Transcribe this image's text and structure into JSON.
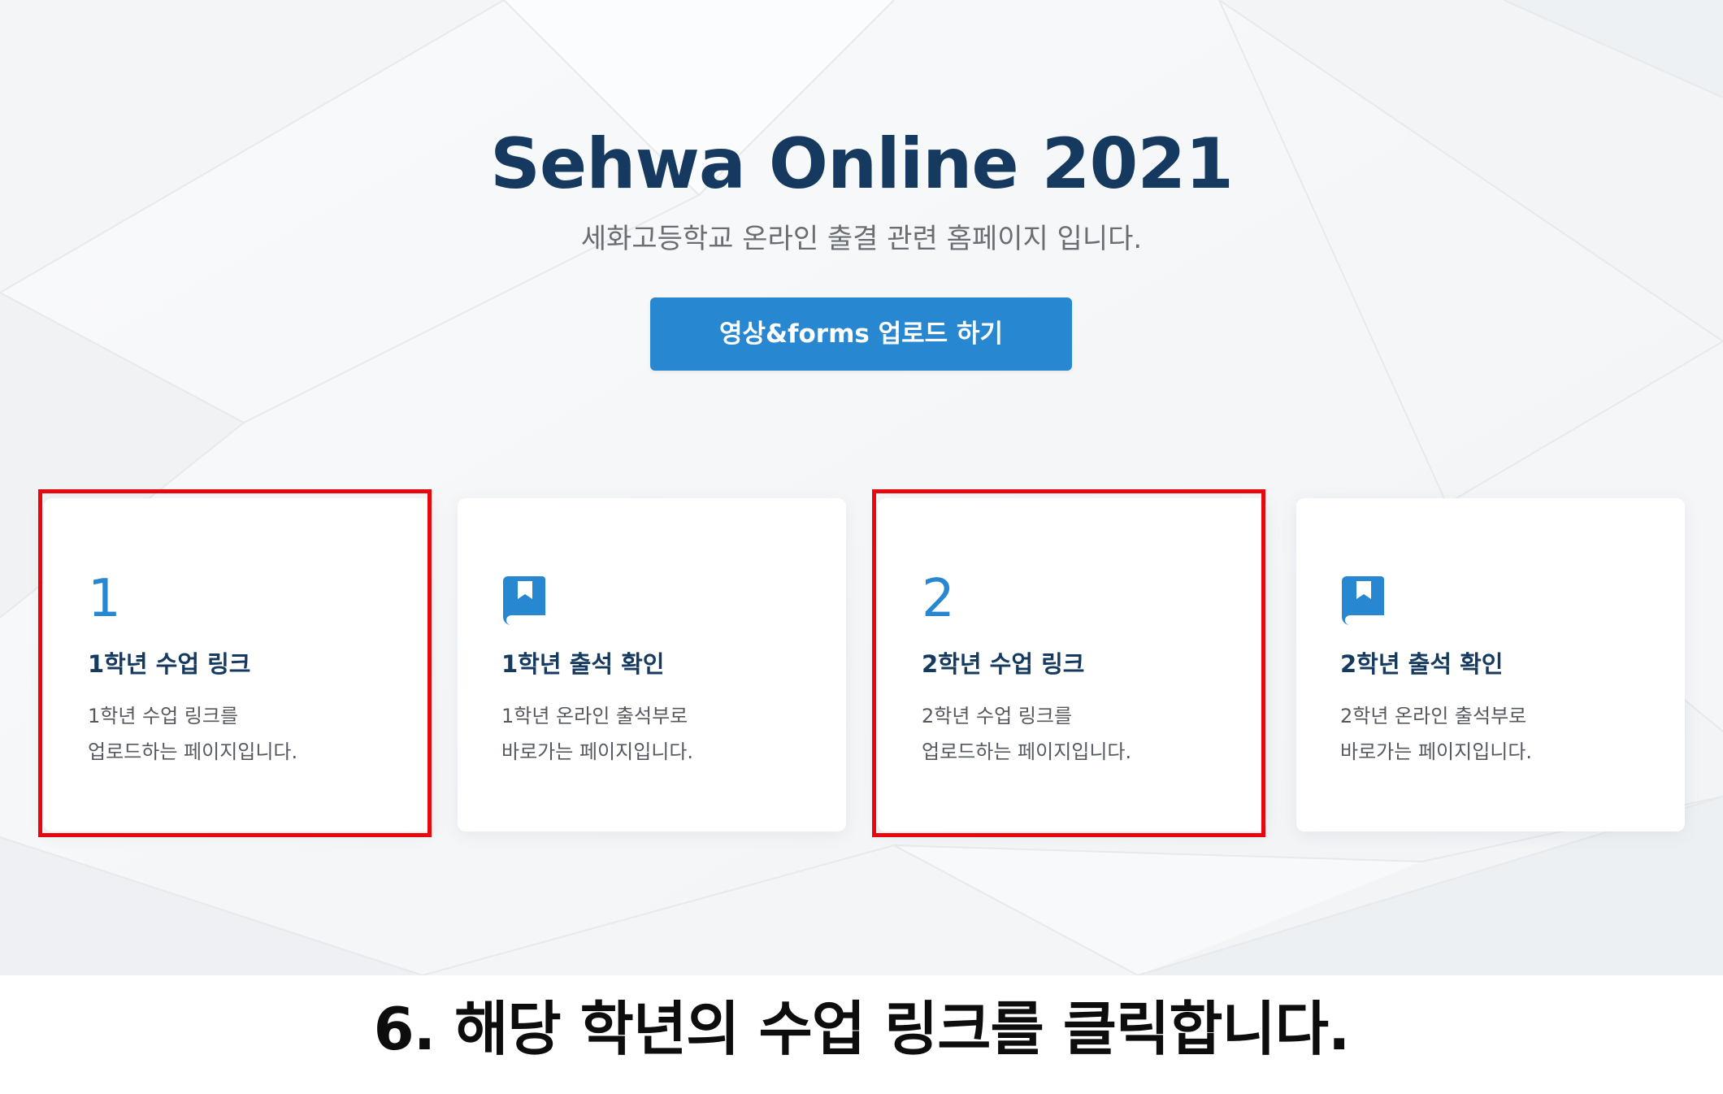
{
  "colors": {
    "hero_background": "#f7f8f9",
    "title": "#163a5f",
    "accent": "#2787d0",
    "subtitle": "#6a6e73",
    "highlight_box": "#e8070c",
    "caption_text": "#0d0d0d"
  },
  "hero": {
    "title": "Sehwa Online 2021",
    "subtitle": "세화고등학교 온라인 출결 관련 홈페이지 입니다.",
    "upload_button_label": "영상&forms 업로드 하기"
  },
  "cards": [
    {
      "badge": "1",
      "title": "1학년 수업 링크",
      "desc_line1": "1학년 수업 링크를",
      "desc_line2": "업로드하는 페이지입니다.",
      "icon": "book-icon",
      "highlighted": true
    },
    {
      "badge": "",
      "title": "1학년 출석 확인",
      "desc_line1": "1학년 온라인 출석부로",
      "desc_line2": "바로가는 페이지입니다.",
      "icon": "book-icon",
      "highlighted": false
    },
    {
      "badge": "2",
      "title": "2학년 수업 링크",
      "desc_line1": "2학년 수업 링크를",
      "desc_line2": "업로드하는 페이지입니다.",
      "icon": "book-icon",
      "highlighted": true
    },
    {
      "badge": "",
      "title": "2학년 출석 확인",
      "desc_line1": "2학년 온라인 출석부로",
      "desc_line2": "바로가는 페이지입니다.",
      "icon": "book-icon",
      "highlighted": false
    }
  ],
  "caption": "6. 해당 학년의 수업 링크를 클릭합니다."
}
